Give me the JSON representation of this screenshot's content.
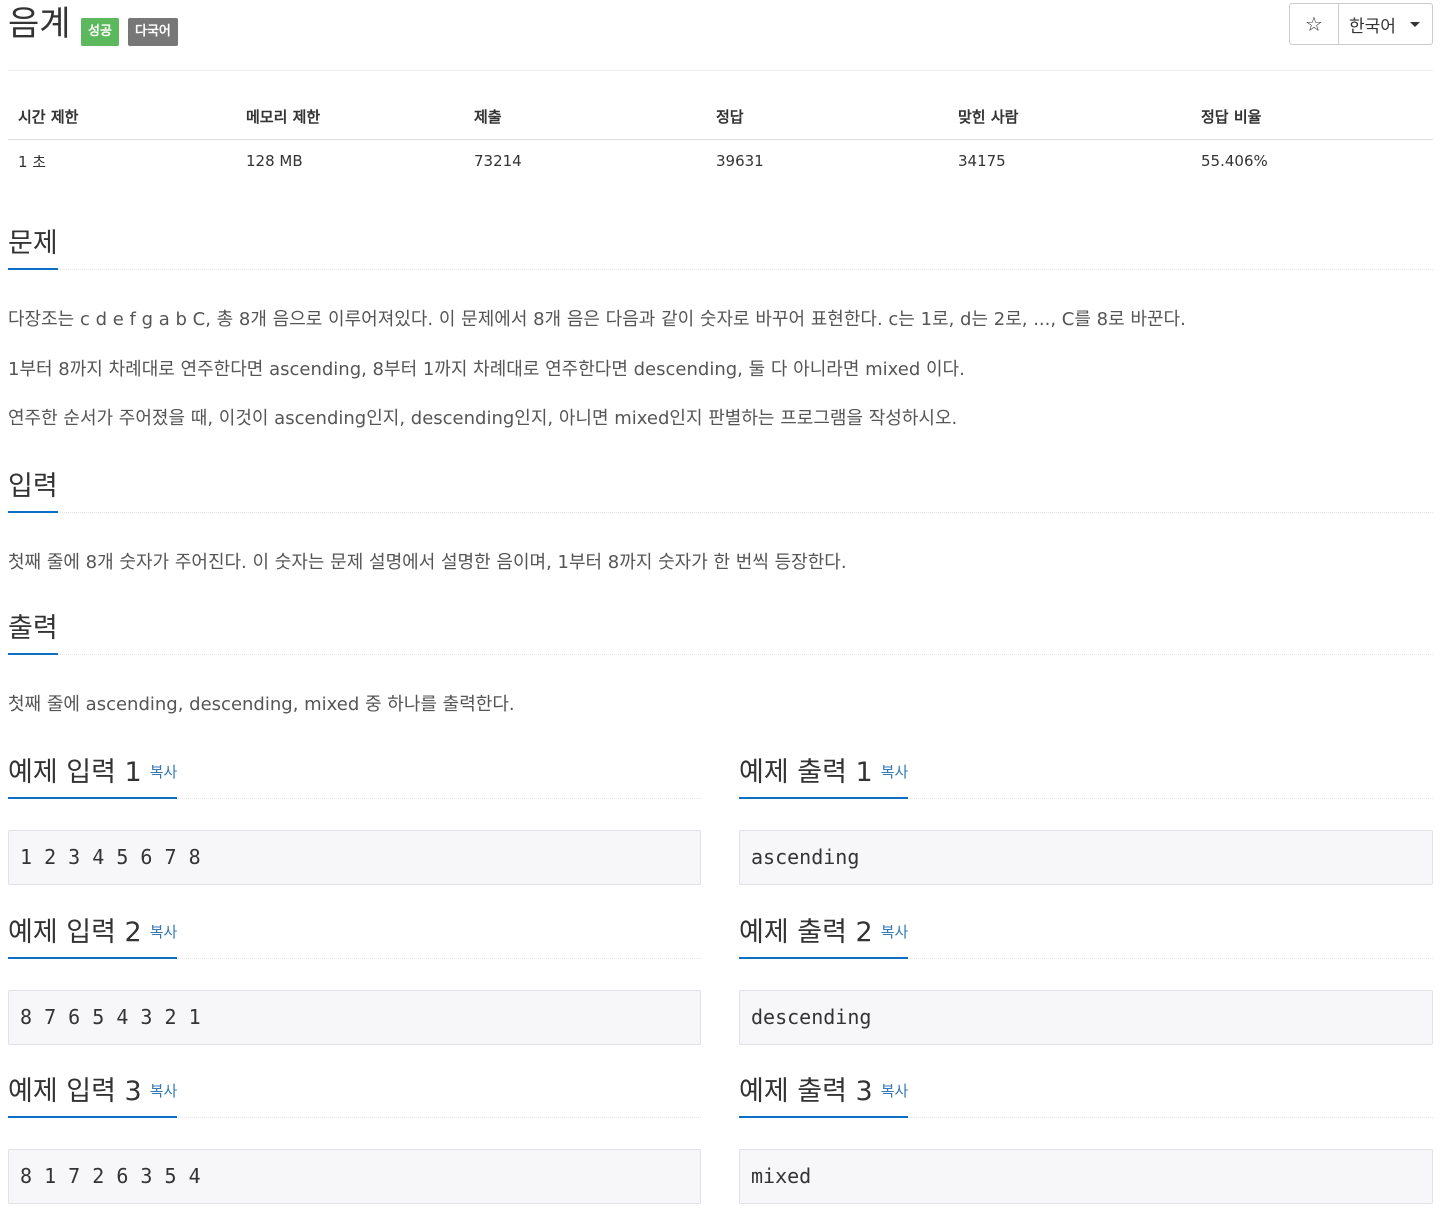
{
  "header": {
    "title": "음계",
    "badge_success": "성공",
    "badge_multi": "다국어",
    "star_icon": "☆",
    "language": "한국어"
  },
  "info": {
    "headers": [
      "시간 제한",
      "메모리 제한",
      "제출",
      "정답",
      "맞힌 사람",
      "정답 비율"
    ],
    "values": [
      "1 초",
      "128 MB",
      "73214",
      "39631",
      "34175",
      "55.406%"
    ]
  },
  "problem": {
    "heading": "문제",
    "paragraphs": [
      "다장조는 c d e f g a b C, 총 8개 음으로 이루어져있다. 이 문제에서 8개 음은 다음과 같이 숫자로 바꾸어 표현한다. c는 1로, d는 2로, ..., C를 8로 바꾼다.",
      "1부터 8까지 차례대로 연주한다면 ascending, 8부터 1까지 차례대로 연주한다면 descending, 둘 다 아니라면 mixed 이다.",
      "연주한 순서가 주어졌을 때, 이것이 ascending인지, descending인지, 아니면 mixed인지 판별하는 프로그램을 작성하시오."
    ]
  },
  "input": {
    "heading": "입력",
    "text": "첫째 줄에 8개 숫자가 주어진다. 이 숫자는 문제 설명에서 설명한 음이며, 1부터 8까지 숫자가 한 번씩 등장한다."
  },
  "output": {
    "heading": "출력",
    "text": "첫째 줄에 ascending, descending, mixed 중 하나를 출력한다."
  },
  "samples": {
    "copy_label": "복사",
    "items": [
      {
        "input_title": "예제 입력 1",
        "input": "1 2 3 4 5 6 7 8",
        "output_title": "예제 출력 1",
        "output": "ascending"
      },
      {
        "input_title": "예제 입력 2",
        "input": "8 7 6 5 4 3 2 1",
        "output_title": "예제 출력 2",
        "output": "descending"
      },
      {
        "input_title": "예제 입력 3",
        "input": "8 1 7 2 6 3 5 4",
        "output_title": "예제 출력 3",
        "output": "mixed"
      }
    ]
  },
  "colors": {
    "success": "#5cb85c",
    "multi": "#777777",
    "link": "#337ab7",
    "section_underline": "#0d6fc4",
    "sample_bg": "#f7f7f9"
  }
}
